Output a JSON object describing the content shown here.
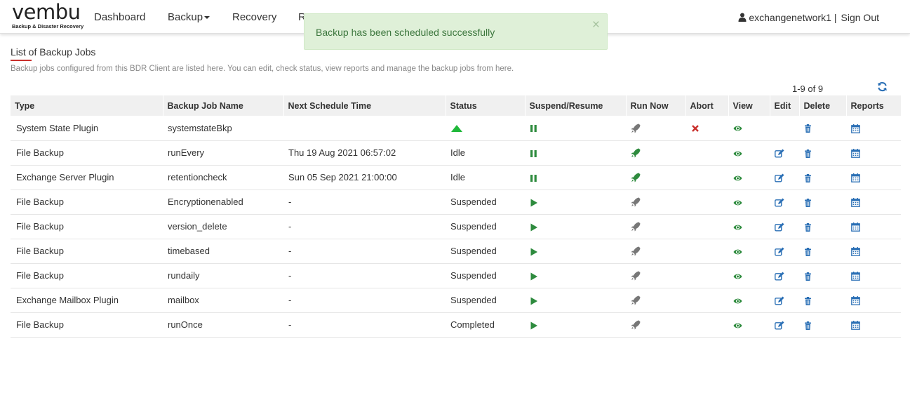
{
  "brand": {
    "name": "vembu",
    "tagline": "Backup & Disaster Recovery"
  },
  "nav": {
    "dashboard": "Dashboard",
    "backup": "Backup",
    "recovery": "Recovery",
    "partial": "R"
  },
  "user": {
    "name": "exchangenetwork1",
    "separator": "|",
    "signout": "Sign Out"
  },
  "alert": {
    "message": "Backup has been scheduled successfully",
    "close": "×"
  },
  "page": {
    "title": "List of Backup Jobs",
    "description": "Backup jobs configured from this BDR Client are listed here. You can edit, check status, view reports and manage the backup jobs from here.",
    "pager": "1-9 of 9"
  },
  "colors": {
    "accent_red": "#c9302c",
    "green": "#2e8b3e",
    "gray_icon": "#777777",
    "blue_icon": "#2a6fb5"
  },
  "table": {
    "headers": [
      "Type",
      "Backup Job Name",
      "Next Schedule Time",
      "Status",
      "Suspend/Resume",
      "Run Now",
      "Abort",
      "View",
      "Edit",
      "Delete",
      "Reports"
    ],
    "rows": [
      {
        "type": "System State Plugin",
        "name": "systemstateBkp",
        "schedule": "",
        "status": "",
        "status_icon": "running-triangle-icon",
        "toggle": "pause-icon",
        "run": "rocket-gray-icon",
        "abort": true,
        "edit": false
      },
      {
        "type": "File Backup",
        "name": "runEvery",
        "schedule": "Thu 19 Aug 2021 06:57:02",
        "status": "Idle",
        "toggle": "pause-icon",
        "run": "rocket-green-icon",
        "abort": false,
        "edit": true
      },
      {
        "type": "Exchange Server Plugin",
        "name": "retentioncheck",
        "schedule": "Sun 05 Sep 2021 21:00:00",
        "status": "Idle",
        "toggle": "pause-icon",
        "run": "rocket-green-icon",
        "abort": false,
        "edit": true
      },
      {
        "type": "File Backup",
        "name": "Encryptionenabled",
        "schedule": "-",
        "status": "Suspended",
        "toggle": "play-icon",
        "run": "rocket-gray-icon",
        "abort": false,
        "edit": true
      },
      {
        "type": "File Backup",
        "name": "version_delete",
        "schedule": "-",
        "status": "Suspended",
        "toggle": "play-icon",
        "run": "rocket-gray-icon",
        "abort": false,
        "edit": true
      },
      {
        "type": "File Backup",
        "name": "timebased",
        "schedule": "-",
        "status": "Suspended",
        "toggle": "play-icon",
        "run": "rocket-gray-icon",
        "abort": false,
        "edit": true
      },
      {
        "type": "File Backup",
        "name": "rundaily",
        "schedule": "-",
        "status": "Suspended",
        "toggle": "play-icon",
        "run": "rocket-gray-icon",
        "abort": false,
        "edit": true
      },
      {
        "type": "Exchange Mailbox Plugin",
        "name": "mailbox",
        "schedule": "-",
        "status": "Suspended",
        "toggle": "play-icon",
        "run": "rocket-gray-icon",
        "abort": false,
        "edit": true
      },
      {
        "type": "File Backup",
        "name": "runOnce",
        "schedule": "-",
        "status": "Completed",
        "toggle": "play-icon",
        "run": "rocket-gray-icon",
        "abort": false,
        "edit": true
      }
    ]
  }
}
